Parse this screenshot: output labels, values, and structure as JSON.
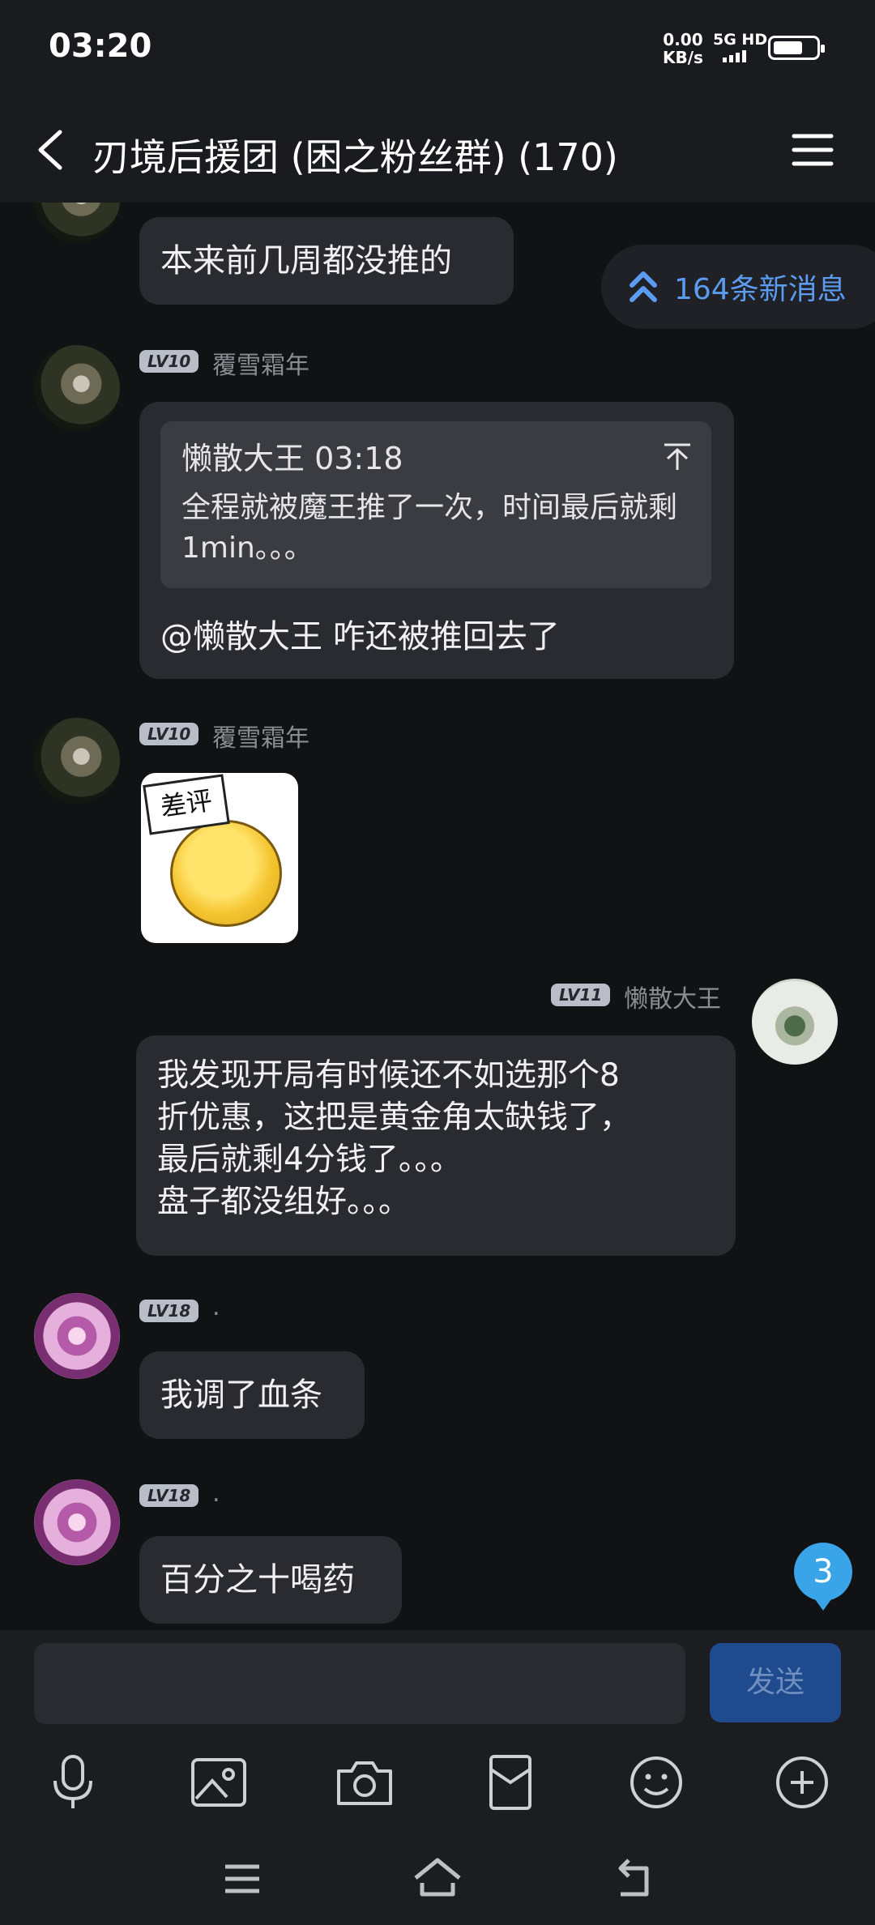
{
  "status_bar": {
    "time": "03:20",
    "net_speed": "0.00",
    "net_unit": "KB/s",
    "signal_label": "5G HD",
    "battery_fraction": 0.7
  },
  "title_bar": {
    "title": "刃境后援团 (困之粉丝群) (170)"
  },
  "new_messages_label": "164条新消息",
  "messages": [
    {
      "text": "本来前几周都没推的"
    },
    {
      "level": "LV10",
      "sender": "覆雪霜年",
      "quote_author_time": "懒散大王 03:18",
      "quote_text": "全程就被魔王推了一次，时间最后就剩1min。。。",
      "text": "@懒散大王 咋还被推回去了"
    },
    {
      "level": "LV10",
      "sender": "覆雪霜年",
      "sticker_text": "差评"
    },
    {
      "level": "LV11",
      "sender": "懒散大王",
      "lines": [
        "我发现开局有时候还不如选那个8",
        "折优惠，这把是黄金角太缺钱了，",
        "最后就剩4分钱了。。。",
        "盘子都没组好。。。"
      ]
    },
    {
      "level": "LV18",
      "sender": ".",
      "text": "我调了血条"
    },
    {
      "level": "LV18",
      "sender": ".",
      "text": "百分之十喝药"
    }
  ],
  "unread_badge": "3",
  "input": {
    "placeholder": "",
    "send_label": "发送"
  },
  "toolbar_icons": [
    "microphone-icon",
    "image-icon",
    "camera-icon",
    "red-packet-icon",
    "emoji-icon",
    "plus-icon"
  ],
  "nav_icons": [
    "menu-icon",
    "home-icon",
    "back-icon"
  ],
  "colors": {
    "accent": "#5b9bf0",
    "send_button": "#1f4a8e",
    "bubble": "#2a2b30",
    "badge": "#3aa4e8"
  }
}
